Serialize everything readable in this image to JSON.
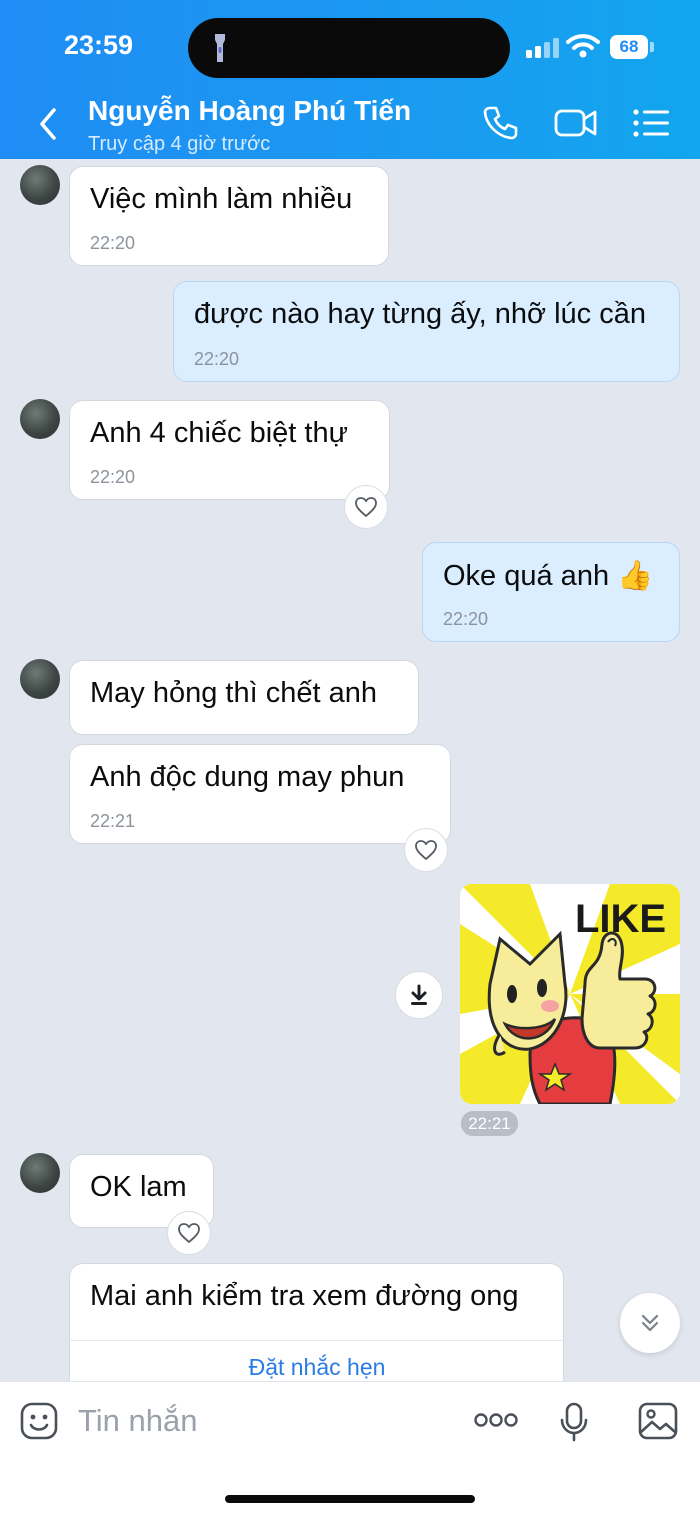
{
  "status_bar": {
    "time": "23:59",
    "battery": "68"
  },
  "header": {
    "contact_name": "Nguyễn Hoàng Phú Tiến",
    "contact_status": "Truy cập 4 giờ trước"
  },
  "messages": [
    {
      "direction": "received",
      "text": "Việc mình làm nhiều",
      "time": "22:20"
    },
    {
      "direction": "sent",
      "text": "được nào hay từng ấy, nhỡ lúc cần",
      "time": "22:20"
    },
    {
      "direction": "received",
      "text": "Anh 4 chiếc biệt thự",
      "time": "22:20"
    },
    {
      "direction": "sent",
      "text": "Oke quá anh 👍",
      "time": "22:20"
    },
    {
      "direction": "received",
      "text": "May hỏng thì chết anh"
    },
    {
      "direction": "received",
      "text": "Anh độc dung may phun",
      "time": "22:21"
    },
    {
      "direction": "sent",
      "type": "sticker",
      "sticker_text": "LIKE",
      "time": "22:21"
    },
    {
      "direction": "received",
      "text": "OK lam"
    },
    {
      "direction": "received",
      "text": "Mai anh kiểm tra xem đường ong",
      "action": "Đặt nhắc hẹn"
    }
  ],
  "input": {
    "placeholder": "Tin nhắn"
  },
  "colors": {
    "header_gradient_start": "#1f8df5",
    "header_gradient_end": "#12a6ee",
    "chat_background": "#e2e6ee",
    "sent_bubble": "#dbeeff",
    "received_bubble": "#ffffff",
    "link": "#2a7be4"
  },
  "icons": {
    "back": "chevron-left-icon",
    "call": "phone-icon",
    "video": "video-camera-icon",
    "menu": "list-menu-icon",
    "reaction": "heart-icon",
    "download": "download-icon",
    "scroll": "double-chevron-down-icon",
    "emoji": "emoji-icon",
    "more": "ellipsis-icon",
    "mic": "microphone-icon",
    "gallery": "image-icon"
  }
}
